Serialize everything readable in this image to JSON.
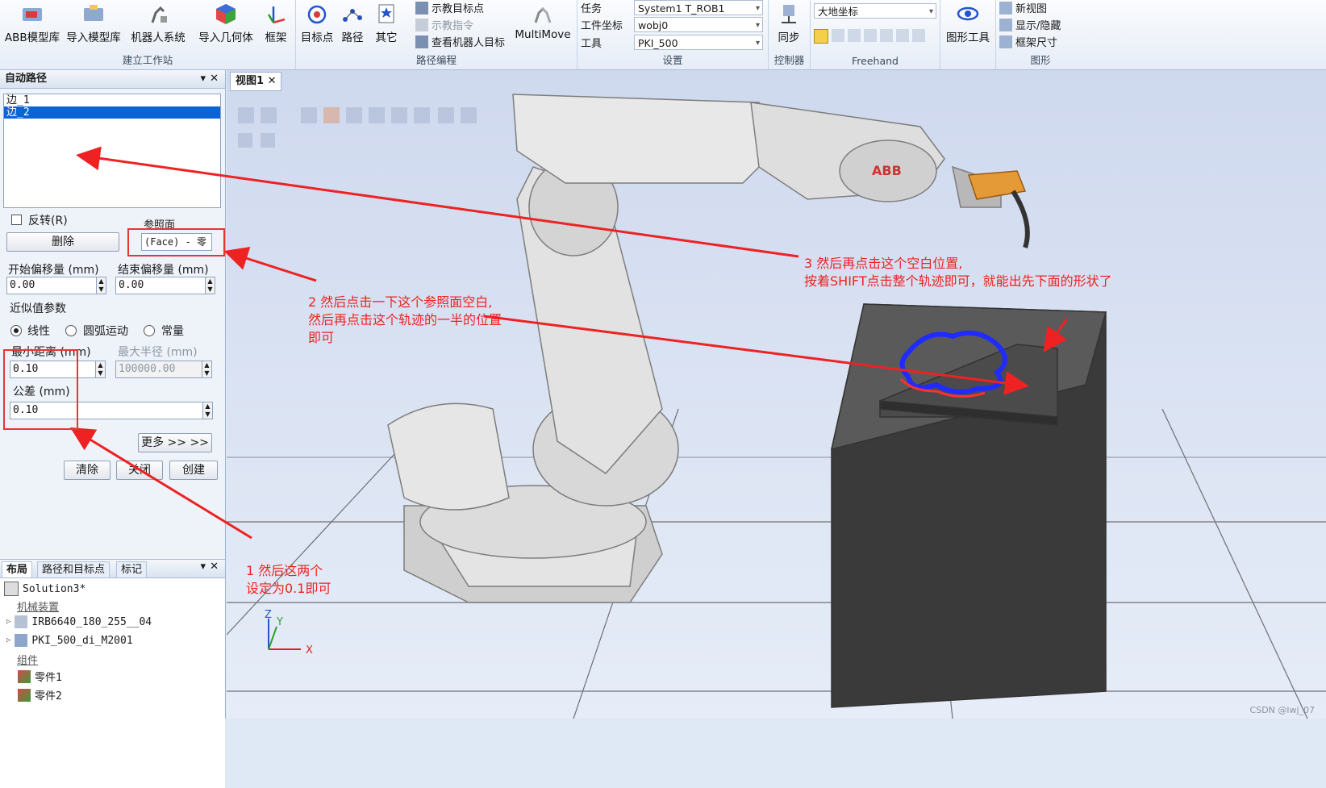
{
  "ribbon": {
    "groups": {
      "build": "建立工作站",
      "path": "路径编程",
      "settings": "设置",
      "controller": "控制器",
      "freehand": "Freehand",
      "graphics": "图形"
    },
    "buttons": {
      "abb_lib": "ABB模型库",
      "import_lib": "导入模型库",
      "robot_system": "机器人系统",
      "import_geometry": "导入几何体",
      "frame": "框架",
      "target": "目标点",
      "path": "路径",
      "other": "其它",
      "teach_target": "示教目标点",
      "teach_instruction": "示教指令",
      "view_robot_target": "查看机器人目标",
      "multimove": "MultiMove",
      "sync": "同步",
      "graphics_tools": "图形工具",
      "new_view": "新视图",
      "show_hide": "显示/隐藏",
      "frame_size": "框架尺寸"
    },
    "settings": {
      "task_label": "任务",
      "task_value": "System1 T_ROB1",
      "wobj_label": "工件坐标",
      "wobj_value": "wobj0",
      "tool_label": "工具",
      "tool_value": "PKI_500",
      "coord_value": "大地坐标"
    }
  },
  "auto_path": {
    "title": "自动路径",
    "edges": [
      "边_1",
      "边_2"
    ],
    "selected_index": 1,
    "reverse_label": "反转(R)",
    "reference_label": "参照面",
    "reference_value": "(Face) - 零",
    "delete_label": "删除",
    "start_offset_label": "开始偏移量 (mm)",
    "start_offset_value": "0.00",
    "end_offset_label": "结束偏移量 (mm)",
    "end_offset_value": "0.00",
    "approx_label": "近似值参数",
    "radio_linear": "线性",
    "radio_arc": "圆弧运动",
    "radio_const": "常量",
    "min_dist_label": "最小距离 (mm)",
    "min_dist_value": "0.10",
    "max_radius_label": "最大半径 (mm)",
    "max_radius_value": "100000.00",
    "tolerance_label": "公差 (mm)",
    "tolerance_value": "0.10",
    "more_label": "更多 >> >>",
    "clear_label": "清除",
    "close_label": "关闭",
    "create_label": "创建"
  },
  "layout_panel": {
    "tabs": [
      "布局",
      "路径和目标点",
      "标记"
    ],
    "tree": {
      "solution": "Solution3*",
      "mechanisms": "机械装置",
      "robot": "IRB6640_180_255__04",
      "tool": "PKI_500_di_M2001",
      "components": "组件",
      "part1": "零件1",
      "part2": "零件2"
    }
  },
  "viewport": {
    "tab": "视图1",
    "axis_x": "X",
    "axis_y": "Y",
    "axis_z": "Z",
    "robot_logo": "ABB"
  },
  "annotations": {
    "a1_line1": "1 然后这两个",
    "a1_line2": "设定为0.1即可",
    "a2_line1": "2 然后点击一下这个参照面空白,",
    "a2_line2": "然后再点击这个轨迹的一半的位置",
    "a2_line3": "即可",
    "a3_line1": "3 然后再点击这个空白位置,",
    "a3_line2": "按着SHIFT点击整个轨迹即可，就能出先下面的形状了"
  },
  "watermark": "CSDN @lwj_07",
  "colors": {
    "annotation": "#ee2222",
    "selection": "#0a64d6",
    "path": "#1f2bff"
  }
}
